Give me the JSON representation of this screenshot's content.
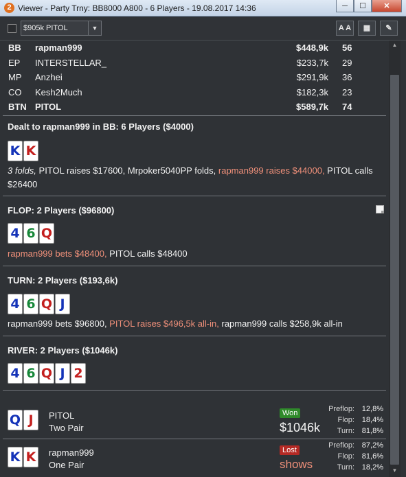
{
  "window": {
    "title": "Viewer - Party Trny: BB8000 A800 - 6 Players - 19.08.2017 14:36",
    "app_icon_glyph": "2",
    "buttons": [
      "minimize",
      "maximize",
      "close"
    ]
  },
  "toolbar": {
    "filter_value": "$905k PITOL",
    "font_button_label": "A A"
  },
  "players": [
    {
      "pos": "BB",
      "name": "rapman999",
      "stack": "$448,9k",
      "bb": "56",
      "bold": true
    },
    {
      "pos": "EP",
      "name": "INTERSTELLAR_",
      "stack": "$233,7k",
      "bb": "29",
      "bold": false
    },
    {
      "pos": "MP",
      "name": "Anzhei",
      "stack": "$291,9k",
      "bb": "36",
      "bold": false
    },
    {
      "pos": "CO",
      "name": "Kesh2Much",
      "stack": "$182,3k",
      "bb": "23",
      "bold": false
    },
    {
      "pos": "BTN",
      "name": "PITOL",
      "stack": "$589,7k",
      "bb": "74",
      "bold": true
    }
  ],
  "preflop": {
    "heading": "Dealt to rapman999 in BB: 6 Players ($4000)",
    "cards": [
      {
        "rank": "K",
        "suit": "s"
      },
      {
        "rank": "K",
        "suit": "h"
      }
    ],
    "action": {
      "folds": "3 folds,",
      "part1": " PITOL raises $17600, Mrpoker5040PP folds, ",
      "hero": "rapman999 raises $44000,",
      "part2": " PITOL calls $26400"
    }
  },
  "flop": {
    "heading": "FLOP: 2 Players ($96800)",
    "cards": [
      {
        "rank": "4",
        "suit": "s"
      },
      {
        "rank": "6",
        "suit": "c"
      },
      {
        "rank": "Q",
        "suit": "h"
      }
    ],
    "action": {
      "hero": "rapman999 bets $48400,",
      "rest": " PITOL calls $48400"
    }
  },
  "turn": {
    "heading": "TURN: 2 Players ($193,6k)",
    "cards": [
      {
        "rank": "4",
        "suit": "s"
      },
      {
        "rank": "6",
        "suit": "c"
      },
      {
        "rank": "Q",
        "suit": "h"
      },
      {
        "rank": "J",
        "suit": "s"
      }
    ],
    "action": {
      "part1": "rapman999 bets $96800, ",
      "villain": "PITOL raises $496,5k all-in,",
      "part2": " rapman999 calls $258,9k all-in"
    }
  },
  "river": {
    "heading": "RIVER: 2 Players ($1046k)",
    "cards": [
      {
        "rank": "4",
        "suit": "s"
      },
      {
        "rank": "6",
        "suit": "c"
      },
      {
        "rank": "Q",
        "suit": "h"
      },
      {
        "rank": "J",
        "suit": "s"
      },
      {
        "rank": "2",
        "suit": "h"
      }
    ]
  },
  "results": [
    {
      "cards": [
        {
          "rank": "Q",
          "suit": "s"
        },
        {
          "rank": "J",
          "suit": "h"
        }
      ],
      "name": "PITOL",
      "hand": "Two Pair",
      "badge": "Won",
      "amount": "$1046k",
      "equity": [
        {
          "label": "Preflop:",
          "value": "12,8%"
        },
        {
          "label": "Flop:",
          "value": "18,4%"
        },
        {
          "label": "Turn:",
          "value": "81,8%"
        }
      ]
    },
    {
      "cards": [
        {
          "rank": "K",
          "suit": "s"
        },
        {
          "rank": "K",
          "suit": "h"
        }
      ],
      "name": "rapman999",
      "hand": "One Pair",
      "badge": "Lost",
      "amount": "shows",
      "equity": [
        {
          "label": "Preflop:",
          "value": "87,2%"
        },
        {
          "label": "Flop:",
          "value": "81,6%"
        },
        {
          "label": "Turn:",
          "value": "18,2%"
        }
      ]
    }
  ],
  "colors": {
    "background": "#2f3236",
    "highlight_text": "#f0907a",
    "won_badge": "#2f8a2a",
    "lost_badge": "#b52a25",
    "spade": "#1433b8",
    "heart": "#c4201f",
    "club": "#18883a"
  }
}
